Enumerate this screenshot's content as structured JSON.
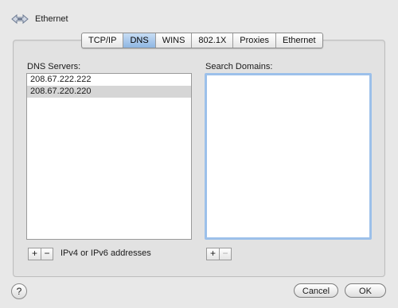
{
  "window": {
    "title": "Ethernet"
  },
  "tabs": [
    {
      "label": "TCP/IP",
      "active": false
    },
    {
      "label": "DNS",
      "active": true
    },
    {
      "label": "WINS",
      "active": false
    },
    {
      "label": "802.1X",
      "active": false
    },
    {
      "label": "Proxies",
      "active": false
    },
    {
      "label": "Ethernet",
      "active": false
    }
  ],
  "dns": {
    "label": "DNS Servers:",
    "servers": [
      "208.67.222.222",
      "208.67.220.220"
    ],
    "selected_index": 1,
    "hint": "IPv4 or IPv6 addresses"
  },
  "search": {
    "label": "Search Domains:"
  },
  "buttons": {
    "add": "+",
    "remove": "−",
    "help": "?",
    "cancel": "Cancel",
    "ok": "OK"
  },
  "colors": {
    "active_tab": "#9dbde8",
    "focus_ring": "#9cc0ea"
  }
}
